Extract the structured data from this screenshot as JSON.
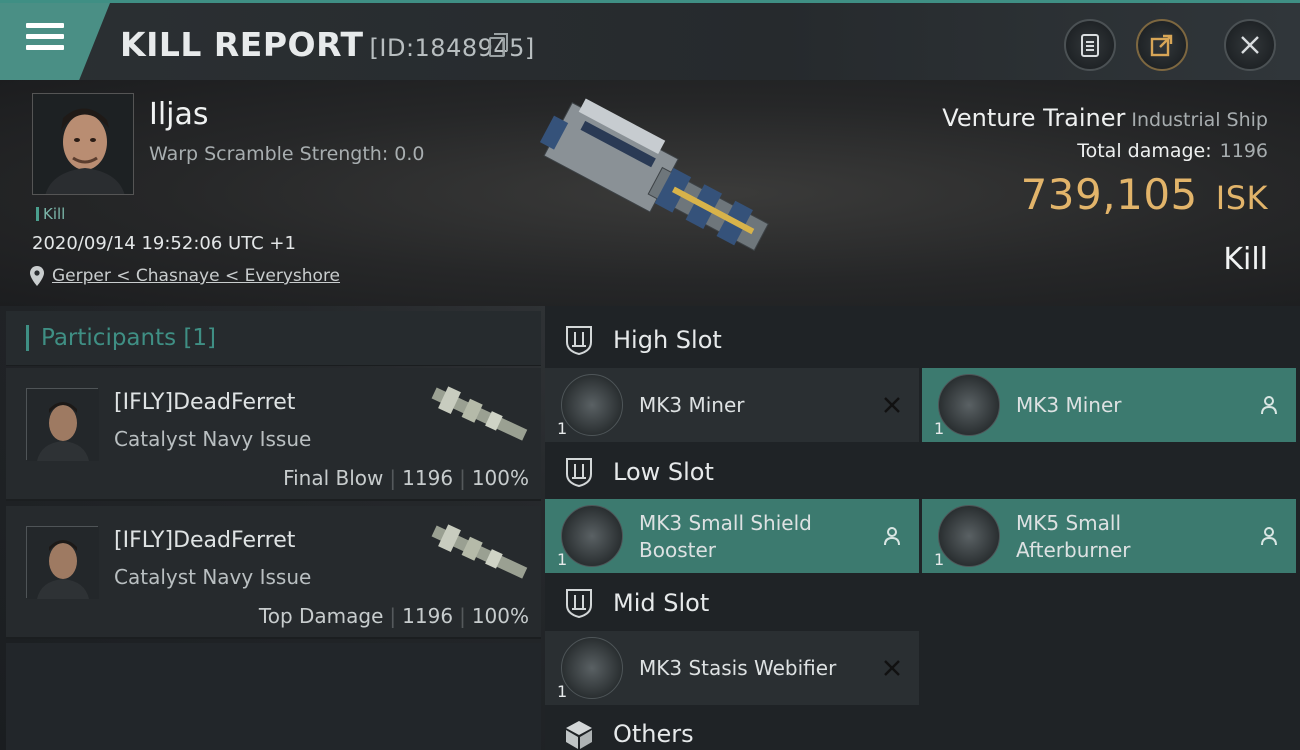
{
  "header": {
    "title": "KILL REPORT",
    "report_id": "[ID:1848945]"
  },
  "victim": {
    "name": "Iljas",
    "warp_scramble": "Warp Scramble Strength: 0.0",
    "tag": "Kill",
    "timestamp": "2020/09/14 19:52:06 UTC +1",
    "location": "Gerper < Chasnaye < Everyshore"
  },
  "ship": {
    "name": "Venture Trainer",
    "class": "Industrial Ship",
    "total_damage_label": "Total damage:",
    "total_damage": "1196",
    "isk_value": "739,105",
    "isk_unit": "ISK",
    "result": "Kill"
  },
  "participants": {
    "heading": "Participants [1]",
    "rows": [
      {
        "name": "[IFLY]DeadFerret",
        "ship": "Catalyst Navy Issue",
        "role": "Final Blow",
        "damage": "1196",
        "percent": "100%"
      },
      {
        "name": "[IFLY]DeadFerret",
        "ship": "Catalyst Navy Issue",
        "role": "Top Damage",
        "damage": "1196",
        "percent": "100%"
      }
    ]
  },
  "slots": {
    "high": {
      "label": "High Slot",
      "items": [
        {
          "name": "MK3 Miner",
          "qty": "1",
          "status": "destroyed"
        },
        {
          "name": "MK3 Miner",
          "qty": "1",
          "status": "dropped"
        }
      ]
    },
    "low": {
      "label": "Low Slot",
      "items": [
        {
          "name": "MK3 Small Shield Booster",
          "qty": "1",
          "status": "dropped"
        },
        {
          "name": "MK5 Small Afterburner",
          "qty": "1",
          "status": "dropped"
        }
      ]
    },
    "mid": {
      "label": "Mid Slot",
      "items": [
        {
          "name": "MK3 Stasis Webifier",
          "qty": "1",
          "status": "destroyed"
        }
      ]
    },
    "others": {
      "label": "Others"
    }
  },
  "colors": {
    "accent": "#3f8f84",
    "isk": "#e2b46a"
  }
}
